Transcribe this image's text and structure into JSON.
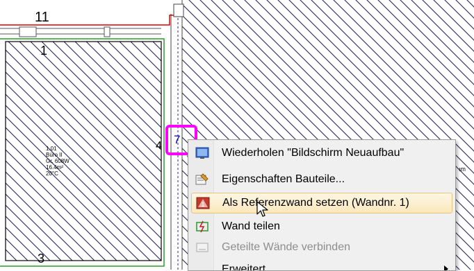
{
  "drawing": {
    "wall_label_top": "11",
    "room_label_top": "1",
    "wall_label_left": "4",
    "wall_label_bottom": "3",
    "selected_wall_number": "7",
    "room": {
      "line1": "1.01",
      "line2": "Büro II",
      "line3": "Gr. 608W",
      "line4": "16.4m²",
      "line5": "20°C"
    },
    "right_fragment": "ım"
  },
  "context_menu": {
    "items": [
      {
        "label": "Wiederholen \"Bildschirm Neuaufbau\"",
        "icon": "refresh-screen-icon",
        "state": "normal"
      },
      {
        "label": "Eigenschaften Bauteile...",
        "icon": "properties-icon",
        "state": "normal"
      },
      {
        "label": "Als Referenzwand setzen (Wandnr. 1)",
        "icon": "reference-wall-icon",
        "state": "hover"
      },
      {
        "label": "Wand teilen",
        "icon": "split-wall-icon",
        "state": "normal"
      },
      {
        "label": "Geteilte Wände verbinden",
        "icon": "join-walls-icon",
        "state": "disabled"
      },
      {
        "label": "Erweitert",
        "icon": "",
        "state": "normal"
      }
    ]
  },
  "colors": {
    "highlight": "#ff00ff",
    "hatch": "#1a1a50",
    "wall_red": "#e00000",
    "wall_green": "#2e9a2e",
    "wall_blue": "#2020c0",
    "menu_hover": "#fbe8bc"
  }
}
